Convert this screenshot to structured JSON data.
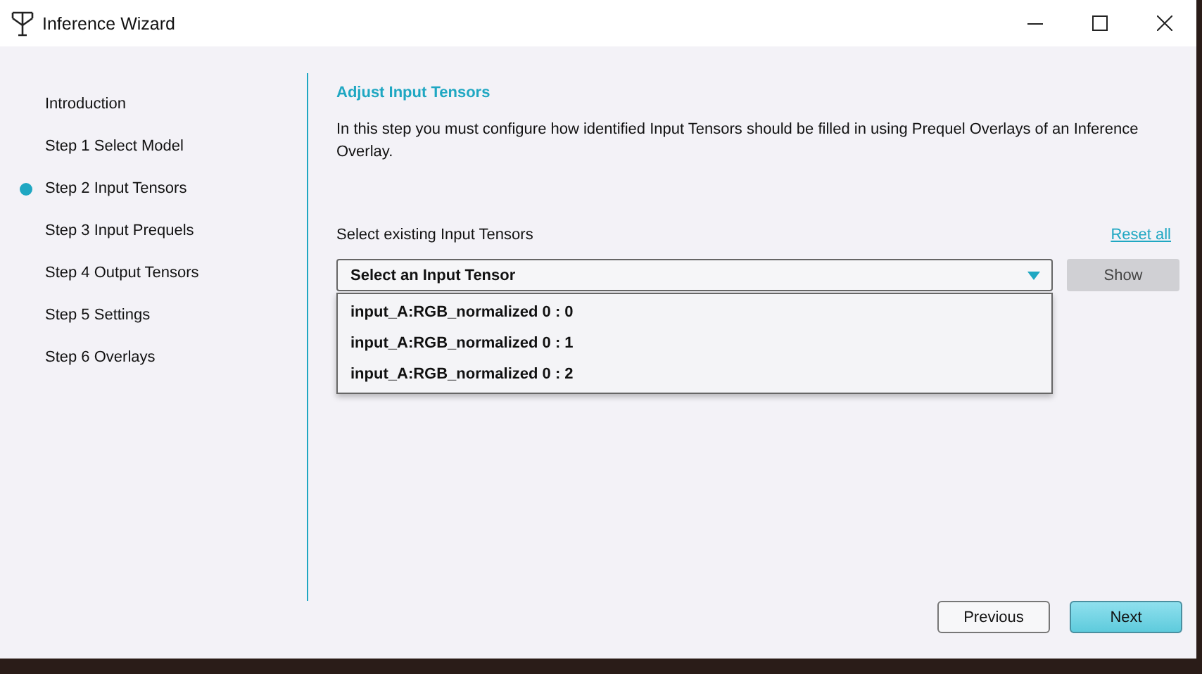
{
  "window": {
    "title": "Inference Wizard"
  },
  "steps": [
    {
      "label": "Introduction",
      "selected": false
    },
    {
      "label": "Step 1 Select Model",
      "selected": false
    },
    {
      "label": "Step 2 Input Tensors",
      "selected": true
    },
    {
      "label": "Step 3 Input Prequels",
      "selected": false
    },
    {
      "label": "Step 4 Output Tensors",
      "selected": false
    },
    {
      "label": "Step 5 Settings",
      "selected": false
    },
    {
      "label": "Step 6 Overlays",
      "selected": false
    }
  ],
  "page": {
    "heading": "Adjust Input Tensors",
    "description": "In this step you must configure how identified Input Tensors should be filled in using Prequel Overlays of an Inference Overlay.",
    "select_label": "Select existing Input Tensors",
    "reset_link": "Reset all",
    "dropdown": {
      "value": "Select an Input Tensor",
      "expanded": true,
      "options": [
        "input_A:RGB_normalized 0 : 0",
        "input_A:RGB_normalized 0 : 1",
        "input_A:RGB_normalized 0 : 2"
      ]
    },
    "show_button": {
      "label": "Show",
      "disabled": true
    }
  },
  "buttons": [
    {
      "label": "Previous",
      "kind": "secondary"
    },
    {
      "label": "Next",
      "kind": "primary"
    }
  ]
}
